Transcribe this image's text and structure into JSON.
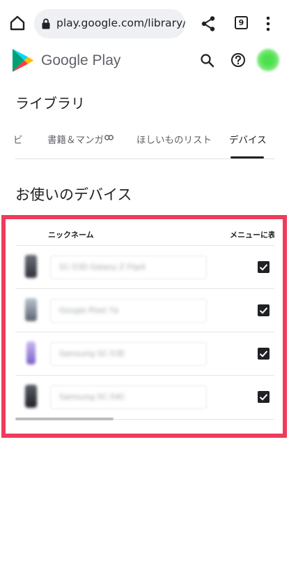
{
  "browser": {
    "url": "play.google.com/library/devices",
    "tab_count": "9",
    "icons": [
      "home-icon",
      "lock-icon",
      "share-icon",
      "more-vert-icon"
    ]
  },
  "header": {
    "brand": "Google Play",
    "icons": [
      "google-play-logo",
      "search-icon",
      "help-icon",
      "avatar"
    ]
  },
  "page": {
    "title": "ライブラリ",
    "tabs": [
      {
        "label": "ビ"
      },
      {
        "label": "書籍＆マンガ"
      },
      {
        "label": "ほしいものリスト"
      },
      {
        "label": "デバイス"
      }
    ],
    "active_tab": "デバイス"
  },
  "devices_section": {
    "title": "お使いのデバイス",
    "columns": {
      "nickname": "ニックネーム",
      "show_in_menu": "メニューに表"
    },
    "rows": [
      {
        "name": "SC-53D Galaxy Z Flip4",
        "checked": true
      },
      {
        "name": "Google Pixel 7a",
        "checked": true
      },
      {
        "name": "Samsung SC-53E",
        "checked": true
      },
      {
        "name": "Samsung SC-54C",
        "checked": true
      }
    ]
  },
  "colors": {
    "highlight": "#ef3b5c",
    "avatar": "#4ce04c",
    "text": "#202124"
  }
}
